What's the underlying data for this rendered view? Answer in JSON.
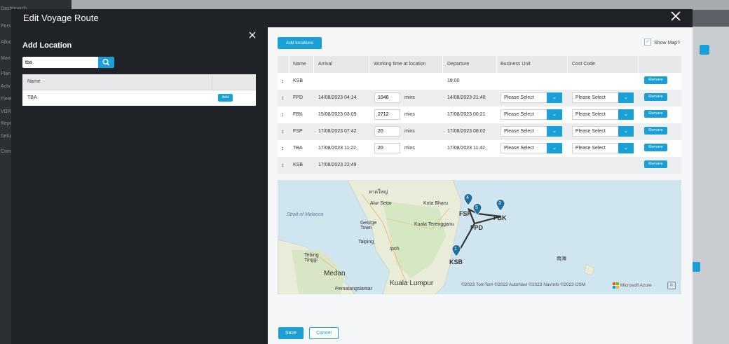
{
  "background": {
    "sidebar_items": [
      "Dashboards",
      "Pers",
      "Alloc",
      "Man",
      "Plan",
      "Actv",
      "Fleet",
      "VDR",
      "Repo",
      "Setup",
      "Com"
    ]
  },
  "modal": {
    "title": "Edit Voyage Route",
    "close_icon": "close-icon"
  },
  "add_location": {
    "title": "Add Location",
    "search_value": "tba",
    "search_icon": "search-icon",
    "table_header": "Name",
    "rows": [
      {
        "name": "TBA",
        "action": "Add"
      }
    ]
  },
  "route": {
    "add_locations_label": "Add locations",
    "show_map_label": "Show Map?",
    "show_map_checked": true,
    "columns": [
      "Name",
      "Arrival",
      "Working time at location",
      "Departure",
      "Business Unit",
      "Cost Code"
    ],
    "rows": [
      {
        "name": "KSB",
        "arrival": "",
        "working_time": "",
        "unit": "",
        "departure": "18:00",
        "business_unit": "",
        "cost_code": "",
        "remove": "Remove"
      },
      {
        "name": "FPD",
        "arrival": "14/08/2023 04:14",
        "working_time": "1046",
        "unit": "mins",
        "departure": "14/08/2023 21:40",
        "business_unit": "Please Select",
        "cost_code": "Please Select",
        "remove": "Remove"
      },
      {
        "name": "FBK",
        "arrival": "15/08/2023 03:09",
        "working_time": "2712",
        "unit": "mins",
        "departure": "17/08/2023 00:21",
        "business_unit": "Please Select",
        "cost_code": "Please Select",
        "remove": "Remove"
      },
      {
        "name": "FSP",
        "arrival": "17/08/2023 07:42",
        "working_time": "20",
        "unit": "mins",
        "departure": "17/08/2023 08:02",
        "business_unit": "Please Select",
        "cost_code": "Please Select",
        "remove": "Remove"
      },
      {
        "name": "TBA",
        "arrival": "17/08/2023 11:22",
        "working_time": "20",
        "unit": "mins",
        "departure": "17/08/2023 11:42",
        "business_unit": "Please Select",
        "cost_code": "Please Select",
        "remove": "Remove"
      },
      {
        "name": "KSB",
        "arrival": "17/08/2023 22:49",
        "working_time": "",
        "unit": "",
        "departure": "",
        "business_unit": "",
        "cost_code": "",
        "remove": "Remove"
      }
    ]
  },
  "map": {
    "place_labels": [
      "หาดใหญ่",
      "Alur Setar",
      "Kota Bharu",
      "Strait of Malacca",
      "George Town",
      "Kuala Terengganu",
      "Taiping",
      "Ipoh",
      "Tebing Tinggi",
      "Medan",
      "Kuala Lumpur",
      "Pematangsiantar",
      "南海"
    ],
    "markers": [
      {
        "num": "1",
        "label": "KSB"
      },
      {
        "num": "3",
        "label": "FBK"
      },
      {
        "num": "4",
        "label": "FSP"
      },
      {
        "num": "5",
        "label": "FPD"
      }
    ],
    "attribution": "©2023 TomTom ©2023 AutoNavi ©2023 NavInfo ©2023 OSM",
    "azure": "Microsoft Azure",
    "info_icon": "info-icon"
  },
  "footer": {
    "save_label": "Save",
    "cancel_label": "Cancel"
  },
  "colors": {
    "accent": "#1a9fd6",
    "modal_bg": "#1f2327",
    "marker": "#1f6fa0"
  }
}
